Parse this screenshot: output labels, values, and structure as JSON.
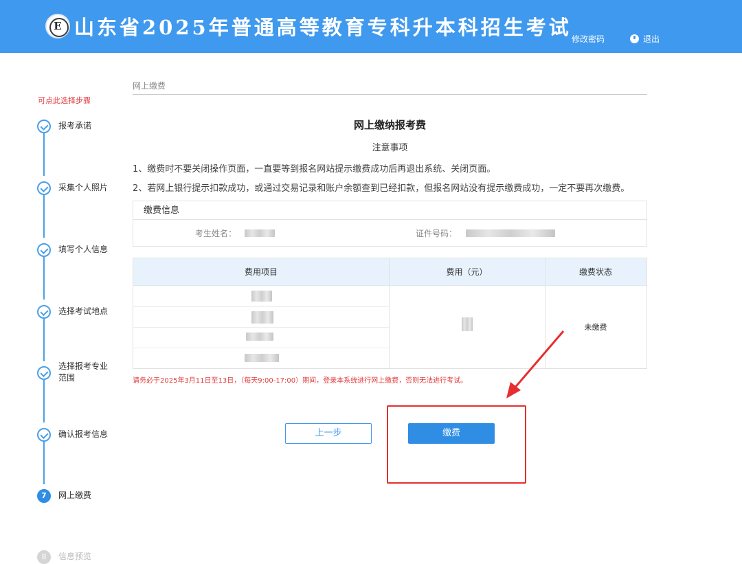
{
  "header": {
    "logo_letter": "E",
    "title": "山东省2025年普通高等教育专科升本科招生考试",
    "change_password": "修改密码",
    "logout": "退出"
  },
  "sidebar": {
    "hint": "可点此选择步骤",
    "steps": [
      {
        "label": "报考承诺",
        "state": "done"
      },
      {
        "label": "采集个人照片",
        "state": "done"
      },
      {
        "label": "填写个人信息",
        "state": "done"
      },
      {
        "label": "选择考试地点",
        "state": "done"
      },
      {
        "label": "选择报考专业范围",
        "state": "done"
      },
      {
        "label": "确认报考信息",
        "state": "done"
      },
      {
        "label": "网上缴费",
        "state": "active",
        "number": "7"
      },
      {
        "label": "信息预览",
        "state": "pending",
        "number": "8"
      }
    ]
  },
  "main": {
    "breadcrumb": "网上缴费",
    "title": "网上缴纳报考费",
    "notice_title": "注意事项",
    "notices": [
      "1、缴费时不要关闭操作页面，一直要等到报名网站提示缴费成功后再退出系统、关闭页面。",
      "2、若网上银行提示扣款成功，或通过交易记录和账户余额查到已经扣款，但报名网站没有提示缴费成功，一定不要再次缴费。"
    ],
    "info": {
      "heading": "缴费信息",
      "name_label": "考生姓名：",
      "id_label": "证件号码："
    },
    "table": {
      "headers": [
        "费用项目",
        "费用（元）",
        "缴费状态"
      ],
      "status": "未缴费"
    },
    "deadline": "请务必于2025年3月11日至13日，（每天9:00-17:00）期间，登录本系统进行网上缴费，否则无法进行考试。",
    "prev_button": "上一步",
    "pay_button": "缴费"
  },
  "colors": {
    "header_bg": "#3f99ee",
    "accent": "#2f8de4",
    "warning_text": "#e03c3c",
    "annotation": "#e62e2e"
  }
}
